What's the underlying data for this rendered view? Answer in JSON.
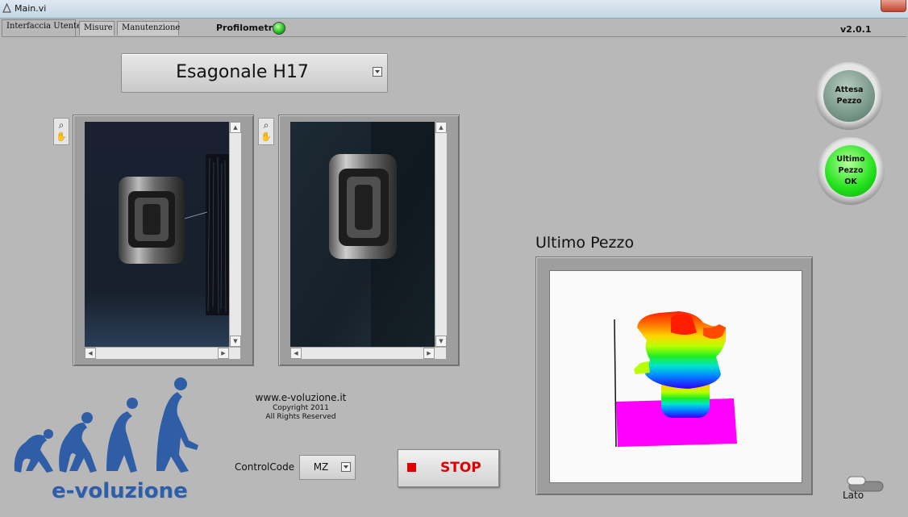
{
  "window": {
    "title": "Main.vi"
  },
  "tabs": [
    {
      "label": "Interfaccia Utente",
      "active": true
    },
    {
      "label": "Misure",
      "active": false
    },
    {
      "label": "Manutenzione",
      "active": false
    }
  ],
  "status": {
    "profilometri_label": "Profilometri",
    "profilometri_led": "on",
    "led_color": "#1bbf1b"
  },
  "version": "v2.0.1",
  "product_select": {
    "value": "Esagonale H17"
  },
  "cameras": [
    {
      "name": "camera-left"
    },
    {
      "name": "camera-right"
    }
  ],
  "indicators": {
    "attesa_pezzo": {
      "label": "Attesa\nPezzo",
      "state": "off",
      "color": "#6e8f80"
    },
    "ultimo_pezzo_ok": {
      "label": "Ultimo\nPezzo\nOK",
      "state": "on",
      "color": "#20e01a"
    }
  },
  "last_piece": {
    "title": "Ultimo Pezzo"
  },
  "footer": {
    "website": "www.e-voluzione.it",
    "copyright": "Copyright 2011",
    "rights": "All Rights Reserved",
    "logo_text": "e-voluzione",
    "logo_color": "#2f5ea7"
  },
  "control_code": {
    "label": "ControlCode",
    "value": "MZ"
  },
  "stop_button": {
    "label": "STOP",
    "color": "#e00000"
  },
  "lato": {
    "label": "Lato",
    "state": "off"
  }
}
